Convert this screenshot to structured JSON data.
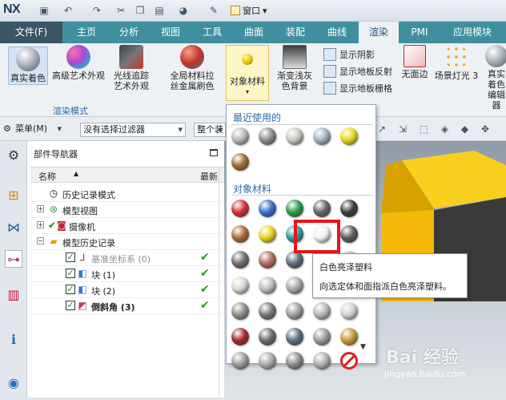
{
  "titlebar": {
    "app_logo": "NX",
    "window_menu": "窗口"
  },
  "tabs": [
    "文件(F)",
    "主页",
    "分析",
    "视图",
    "工具",
    "曲面",
    "装配",
    "曲线",
    "渲染",
    "PMI",
    "应用模块"
  ],
  "ribbon": {
    "items": [
      "真实着色",
      "高级艺术外观",
      "光线追踪艺术外观",
      "全局材料拉丝金属刷色",
      "对象材料",
      "渐变浅灰色背景",
      "无面边",
      "场景灯光 3",
      "真实着色编辑器"
    ],
    "group_label": "渲染模式",
    "small_buttons": [
      "显示阴影",
      "显示地板反射",
      "显示地板栅格"
    ]
  },
  "cmdbar": {
    "menu": "菜单(M)",
    "filter": "没有选择过滤器",
    "assembly": "整个装配"
  },
  "navigator": {
    "title": "部件导航器",
    "col_name": "名称",
    "col_latest": "最新",
    "rows": [
      "历史记录模式",
      "模型视图",
      "摄像机",
      "模型历史记录",
      "基准坐标系 (0)",
      "块 (1)",
      "块 (2)",
      "倒斜角 (3)"
    ]
  },
  "dropdown": {
    "recent_title": "最近使用的",
    "materials_title": "对象材料"
  },
  "tooltip": {
    "title": "白色亮泽塑料",
    "desc": "向选定体和面指派白色亮泽塑料。"
  },
  "watermark": {
    "brand": "Bai 经验",
    "url": "jingyan.baidu.com"
  },
  "colors": {
    "tab_bar": "#3f8fa0",
    "file_tab": "#3a5564",
    "accent": "#2a6aa8",
    "highlight": "#e8141a",
    "cube_yellow": "#f6c20a"
  }
}
